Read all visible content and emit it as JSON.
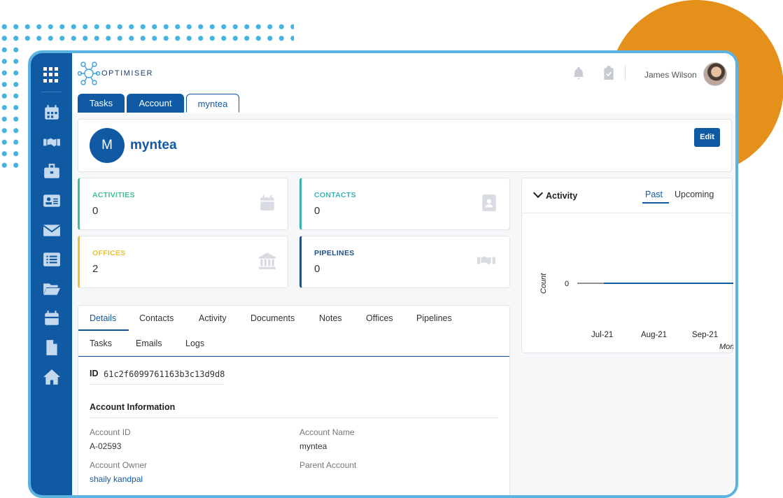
{
  "brand": {
    "name": "OPTIMISER"
  },
  "user": {
    "name": "James Wilson"
  },
  "tabs": [
    {
      "label": "Tasks"
    },
    {
      "label": "Account"
    },
    {
      "label": "myntea"
    }
  ],
  "account": {
    "initial": "M",
    "name": "myntea",
    "edit_label": "Edit"
  },
  "stats": [
    {
      "label": "ACTIVITIES",
      "value": "0",
      "color": "#3fbf8f",
      "icon": "calendar-icon"
    },
    {
      "label": "CONTACTS",
      "value": "0",
      "color": "#3ab1b0",
      "icon": "contact-card-icon"
    },
    {
      "label": "OFFICES",
      "value": "2",
      "color": "#e8c03a",
      "icon": "bank-icon"
    },
    {
      "label": "PIPELINES",
      "value": "0",
      "color": "#1e4f85",
      "icon": "handshake-icon"
    }
  ],
  "activity": {
    "title": "Activity",
    "tabs": [
      "Past",
      "Upcoming"
    ],
    "chart": {
      "ylabel": "Count",
      "y_tick": "0",
      "x_ticks": [
        "Jul-21",
        "Aug-21",
        "Sep-21"
      ],
      "xlabel_partial": "Mon"
    }
  },
  "details": {
    "tabs_row1": [
      "Details",
      "Contacts",
      "Activity",
      "Documents",
      "Notes",
      "Offices",
      "Pipelines"
    ],
    "tabs_row2": [
      "Tasks",
      "Emails",
      "Logs"
    ],
    "id_label": "ID",
    "id_value": "61c2f6099761163b3c13d9d8",
    "section_title": "Account Information",
    "fields": {
      "account_id_label": "Account ID",
      "account_id_value": "A-02593",
      "account_name_label": "Account Name",
      "account_name_value": "myntea",
      "account_owner_label": "Account Owner",
      "account_owner_value": "shaily kandpal",
      "parent_account_label": "Parent Account"
    }
  },
  "colors": {
    "primary": "#0f5aa3",
    "orange": "#e6901c",
    "frame": "#5ab3e0"
  },
  "sidebar_icons": [
    "calendar-icon",
    "handshake-icon",
    "briefcase-icon",
    "contact-card-icon",
    "mail-icon",
    "list-icon",
    "folder-open-icon",
    "calendar-alt-icon",
    "file-icon",
    "home-icon"
  ]
}
